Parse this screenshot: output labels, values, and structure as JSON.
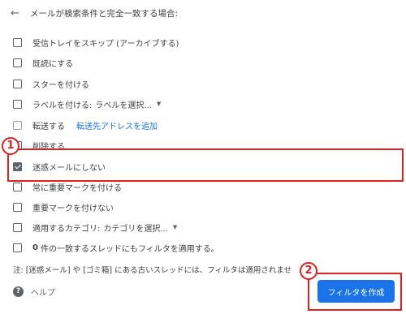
{
  "header": {
    "back_icon": "arrow-left-icon",
    "title": "メールが検索条件と完全一致する場合:"
  },
  "options": {
    "skip_inbox": "受信トレイをスキップ (アーカイブする)",
    "mark_read": "既読にする",
    "star": "スターを付ける",
    "apply_label": "ラベルを付ける:",
    "label_select": "ラベルを選択...",
    "forward": "転送する",
    "forward_link": "転送先アドレスを追加",
    "delete": "削除する",
    "never_spam": "迷惑メールにしない",
    "always_important": "常に重要マークを付ける",
    "never_important": "重要マークを付けない",
    "categorize": "適用するカテゴリ:",
    "category_select": "カテゴリを選択...",
    "also_apply_count": "0",
    "also_apply_rest": "件の一致するスレッドにもフィルタを適用する。"
  },
  "note": "注: [迷惑メール] や [ゴミ箱] にある古いスレッドには、フィルタは適用されませ",
  "help": {
    "icon": "?",
    "label": "ヘルプ"
  },
  "create_button": "フィルタを作成",
  "annotations": {
    "badge1": "1",
    "badge2": "2",
    "color": "#e02020"
  },
  "colors": {
    "accent": "#1a73e8",
    "text": "#3c4043",
    "checkbox": "#5f6368"
  }
}
